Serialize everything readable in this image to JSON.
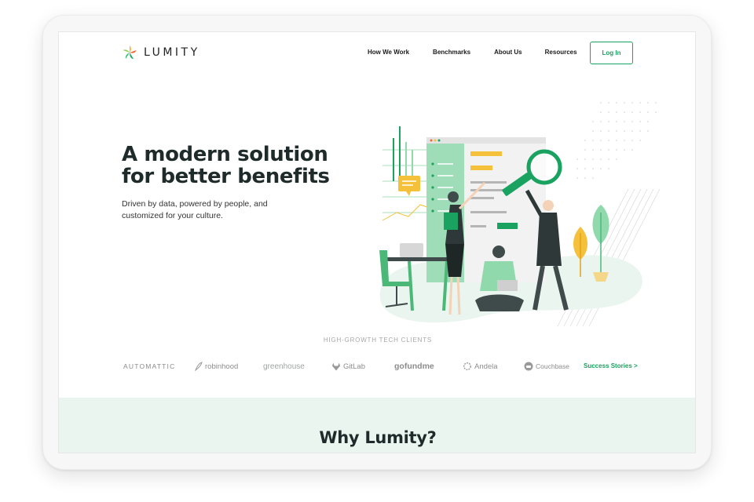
{
  "brand": {
    "name": "LUMITY",
    "accent": "#1aa260",
    "dark": "#1f2a2b",
    "band": "#eaf5ef"
  },
  "nav": {
    "items": [
      {
        "label": "How We Work"
      },
      {
        "label": "Benchmarks"
      },
      {
        "label": "About Us"
      },
      {
        "label": "Resources"
      }
    ],
    "login_label": "Log In"
  },
  "hero": {
    "title_line1": "A modern solution",
    "title_line2": "for better benefits",
    "subtitle_line1": "Driven by data, powered by people, and",
    "subtitle_line2": "customized for your culture."
  },
  "clients": {
    "heading": "HIGH-GROWTH TECH CLIENTS",
    "logos": [
      {
        "name": "AUTOMATTIC",
        "icon": "none"
      },
      {
        "name": "robinhood",
        "icon": "feather-icon"
      },
      {
        "name": "greenhouse",
        "icon": "none"
      },
      {
        "name": "GitLab",
        "icon": "fox-icon"
      },
      {
        "name": "gofundme",
        "icon": "none"
      },
      {
        "name": "Andela",
        "icon": "gear-ring-icon"
      },
      {
        "name": "Couchbase",
        "icon": "couch-circle-icon"
      }
    ],
    "success_link": "Success Stories  >"
  },
  "section": {
    "title": "Why Lumity?"
  }
}
